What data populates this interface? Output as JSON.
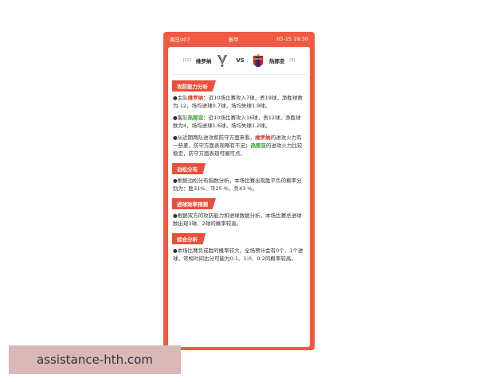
{
  "header": {
    "match_id": "周日007",
    "league": "意甲",
    "datetime": "03-15 19:30"
  },
  "match": {
    "home": {
      "rank": "[12]",
      "name": "维罗纳"
    },
    "vs": "VS",
    "away": {
      "name": "热那亚",
      "rank": "[8]"
    }
  },
  "sections": {
    "attack": {
      "title": "攻防能力分析",
      "p1": {
        "a": "●主队",
        "team": "维罗纳",
        "b": "：近10场比赛攻入7球，丢19球，净胜球数为-12，场均进球0.7球，场均失球1.9球。"
      },
      "p2": {
        "a": "●客队",
        "team": "热那亚",
        "b": "：近10场比赛攻入16球，丢12球，净胜球数为4，场均进球1.6球，场均失球1.2球。"
      },
      "p3": {
        "a": "●从近期两队进攻和防守方面来看，",
        "team1": "维罗纳",
        "b": "的进攻火力有一些差，防守方面表现略有不足；",
        "team2": "热那亚",
        "c": "的进攻火力比较稳定，防守方面表现可圈可点。"
      }
    },
    "poisson": {
      "title": "泊松分布",
      "p": "●根据泊松分布指数分析，本场比赛出现胜平负的概率分别为：胜31%、平25 %、负43 %。"
    },
    "goals": {
      "title": "进球效率预测",
      "p": "●根据双方的攻防能力和进球数据分析，本场比赛总进球数出现3球、2球的概率较高。"
    },
    "summary": {
      "title": "综合分析",
      "p": "●本场比赛负或胜的概率较大，全场预计会有0个、1个进球，常规时间比分可能为0:1、1:0、0:2的概率较高。"
    }
  },
  "watermark": "assistance-hth.com",
  "colors": {
    "accent": "#ef5a43",
    "title_bg": "#e8503a",
    "home_team": "#d9321e",
    "away_team": "#2aa12a"
  },
  "icons": {
    "home_crest": "verona-crest-icon",
    "away_crest": "genoa-crest-icon"
  }
}
